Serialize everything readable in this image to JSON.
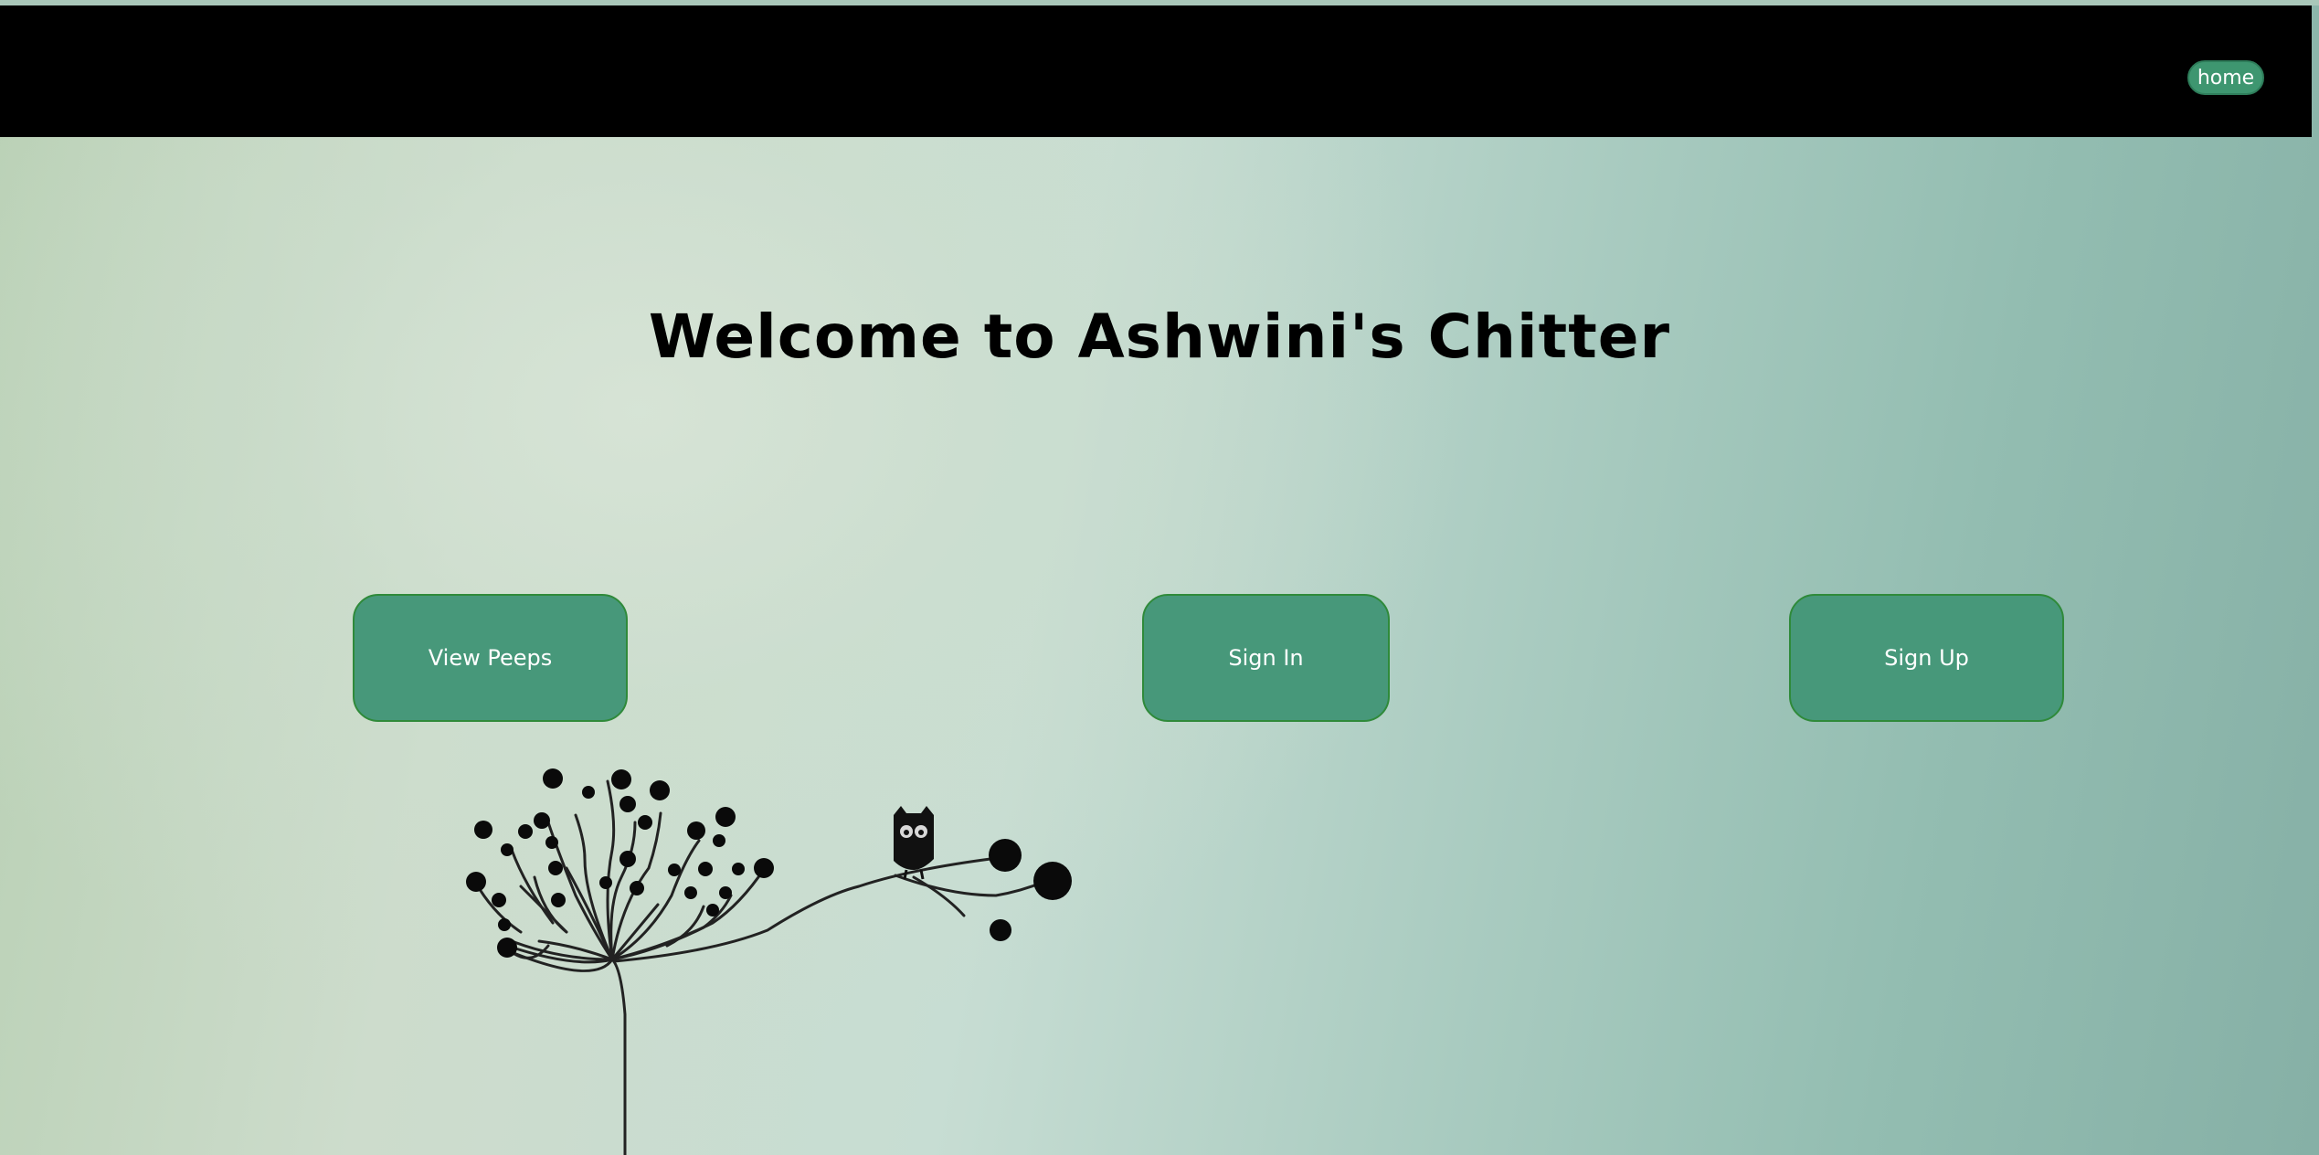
{
  "nav": {
    "home_label": "home",
    "bar_color": "#000000"
  },
  "hero": {
    "title": "Welcome to Ashwini's Chitter"
  },
  "actions": [
    {
      "label": "View Peeps"
    },
    {
      "label": "Sign In"
    },
    {
      "label": "Sign Up"
    }
  ],
  "colors": {
    "button": "#47987a",
    "button_border": "#2f8a3a",
    "home_button": "#3e9670"
  },
  "decoration": {
    "icon": "tree-with-owl-illustration"
  }
}
